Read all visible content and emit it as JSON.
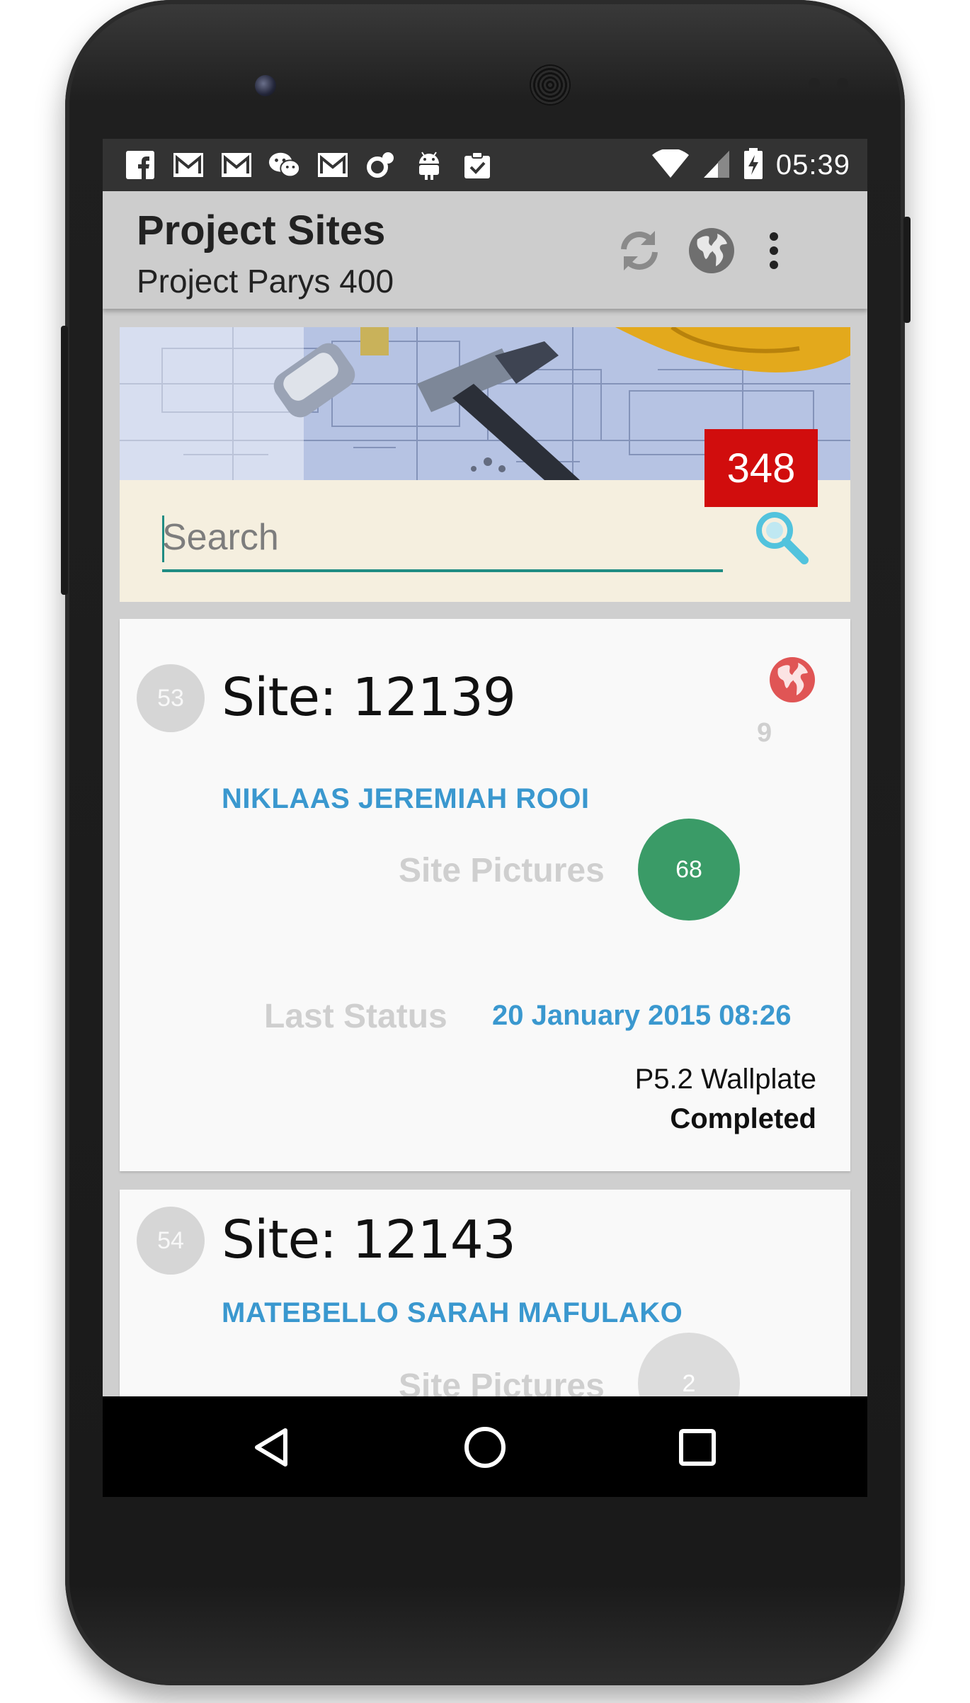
{
  "status_bar": {
    "time": "05:39",
    "notification_icons": [
      "facebook-icon",
      "gmail-icon",
      "gmail-icon",
      "wechat-icon",
      "gmail-icon",
      "sync-link-icon",
      "android-icon",
      "clipboard-check-icon"
    ],
    "system_icons": [
      "wifi-icon",
      "signal-icon",
      "battery-charging-icon"
    ]
  },
  "app_bar": {
    "title": "Project Sites",
    "subtitle": "Project Parys 400",
    "actions": [
      "refresh-icon",
      "globe-icon",
      "overflow-menu-icon"
    ]
  },
  "header": {
    "site_count": "348",
    "search": {
      "placeholder": "Search",
      "value": ""
    }
  },
  "sites": [
    {
      "index": "53",
      "title": "Site: 12139",
      "owner": "NIKLAAS JEREMIAH ROOI",
      "geo_count": "9",
      "pictures_label": "Site Pictures",
      "pictures_count": "68",
      "last_status_label": "Last Status",
      "last_status_date": "20 January 2015 08:26",
      "stage": "P5.2 Wallplate",
      "stage_status": "Completed"
    },
    {
      "index": "54",
      "title": "Site: 12143",
      "owner": "MATEBELLO SARAH MAFULAKO",
      "pictures_label": "Site Pictures",
      "pictures_count": "2"
    }
  ],
  "nav_bar": {
    "buttons": [
      "back-icon",
      "home-icon",
      "recents-icon"
    ]
  },
  "colors": {
    "accent_blue": "#3a98cf",
    "pictures_green": "#3a9b67",
    "count_red": "#d10d0d",
    "search_underline": "#1f8c83",
    "geo_red": "#e05555"
  }
}
